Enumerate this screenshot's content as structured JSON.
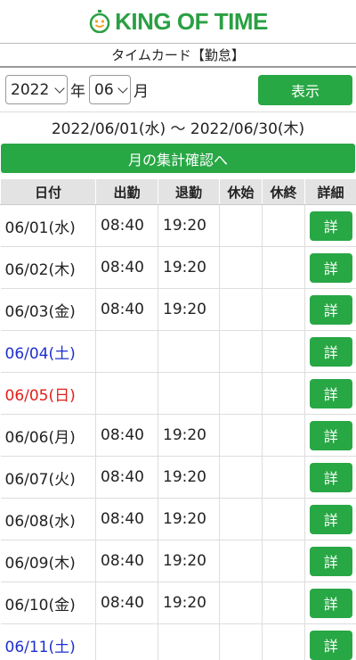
{
  "brand": {
    "logo_text": "KING OF TIME",
    "accent": "#28a745"
  },
  "page": {
    "subtitle": "タイムカード【勤怠】"
  },
  "controls": {
    "year_value": "2022",
    "year_unit": "年",
    "month_value": "06",
    "month_unit": "月",
    "show_label": "表示"
  },
  "period": {
    "range_text": "2022/06/01(水) ～ 2022/06/30(木)"
  },
  "summary_button": "月の集計確認へ",
  "table": {
    "headers": [
      "日付",
      "出勤",
      "退勤",
      "休始",
      "休終",
      "詳細"
    ],
    "detail_label": "詳",
    "rows": [
      {
        "date": "06/01(水)",
        "in": "08:40",
        "out": "19:20",
        "bstart": "",
        "bend": "",
        "day": "weekday"
      },
      {
        "date": "06/02(木)",
        "in": "08:40",
        "out": "19:20",
        "bstart": "",
        "bend": "",
        "day": "weekday"
      },
      {
        "date": "06/03(金)",
        "in": "08:40",
        "out": "19:20",
        "bstart": "",
        "bend": "",
        "day": "weekday"
      },
      {
        "date": "06/04(土)",
        "in": "",
        "out": "",
        "bstart": "",
        "bend": "",
        "day": "sat"
      },
      {
        "date": "06/05(日)",
        "in": "",
        "out": "",
        "bstart": "",
        "bend": "",
        "day": "sun"
      },
      {
        "date": "06/06(月)",
        "in": "08:40",
        "out": "19:20",
        "bstart": "",
        "bend": "",
        "day": "weekday"
      },
      {
        "date": "06/07(火)",
        "in": "08:40",
        "out": "19:20",
        "bstart": "",
        "bend": "",
        "day": "weekday"
      },
      {
        "date": "06/08(水)",
        "in": "08:40",
        "out": "19:20",
        "bstart": "",
        "bend": "",
        "day": "weekday"
      },
      {
        "date": "06/09(木)",
        "in": "08:40",
        "out": "19:20",
        "bstart": "",
        "bend": "",
        "day": "weekday"
      },
      {
        "date": "06/10(金)",
        "in": "08:40",
        "out": "19:20",
        "bstart": "",
        "bend": "",
        "day": "weekday"
      },
      {
        "date": "06/11(土)",
        "in": "",
        "out": "",
        "bstart": "",
        "bend": "",
        "day": "sat"
      }
    ]
  }
}
